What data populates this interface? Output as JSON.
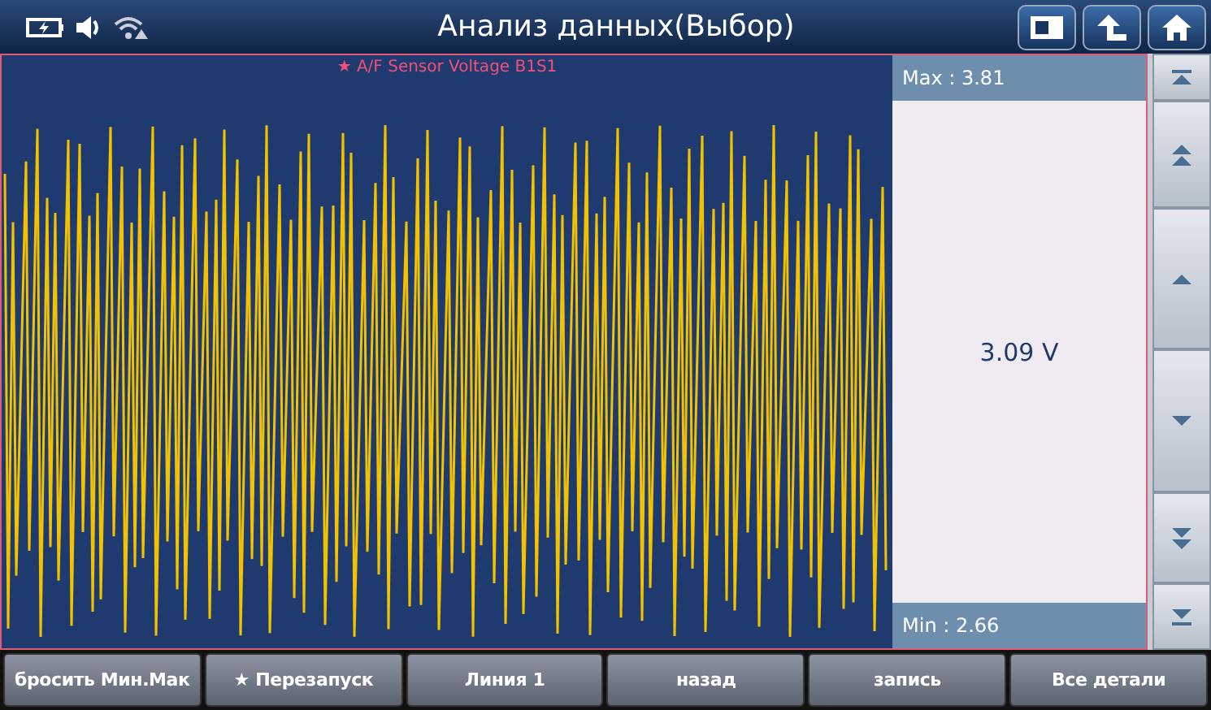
{
  "header": {
    "title": "Анализ данных(Выбор)"
  },
  "graph": {
    "title": "★ A/F Sensor Voltage B1S1"
  },
  "readout": {
    "max": "Max : 3.81",
    "value": "3.09 V",
    "min": "Min : 2.66"
  },
  "buttons": [
    "бросить Мин.Мак",
    "★ Перезапуск",
    "Линия 1",
    "назад",
    "запись",
    "Все детали"
  ]
}
